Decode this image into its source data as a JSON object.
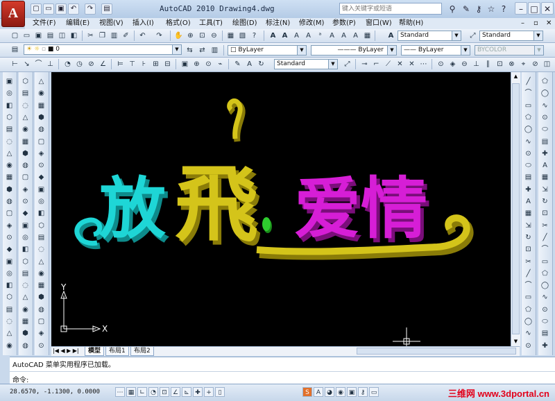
{
  "window": {
    "title": "AutoCAD 2010  Drawing4.dwg",
    "logo": "A"
  },
  "search": {
    "placeholder": "键入关键字或短语"
  },
  "menu": [
    "文件(F)",
    "编辑(E)",
    "视图(V)",
    "插入(I)",
    "格式(O)",
    "工具(T)",
    "绘图(D)",
    "标注(N)",
    "修改(M)",
    "参数(P)",
    "窗口(W)",
    "帮助(H)"
  ],
  "styles": {
    "text_style": "Standard",
    "dim_style": "Standard",
    "table_style": "Standard"
  },
  "layers": {
    "current": "0"
  },
  "properties": {
    "color": "ByLayer",
    "linetype": "ByLayer",
    "lineweight": "ByLayer",
    "plotstyle": "BYCOLOR"
  },
  "drawing": {
    "words": [
      {
        "text": "放",
        "color": "#1ed6d6"
      },
      {
        "text": "飛",
        "color": "#d4c41a"
      },
      {
        "text": "爱情",
        "color": "#d61ed6"
      }
    ],
    "ucs": {
      "x_label": "X",
      "y_label": "Y"
    }
  },
  "tabs": [
    "模型",
    "布局1",
    "布局2"
  ],
  "command": {
    "history": "AutoCAD 菜单实用程序已加载。",
    "prompt": "命令:"
  },
  "status": {
    "coordinates": "28.6570, -1.1300, 0.0000"
  },
  "watermark": "三维网 www.3dportal.cn"
}
